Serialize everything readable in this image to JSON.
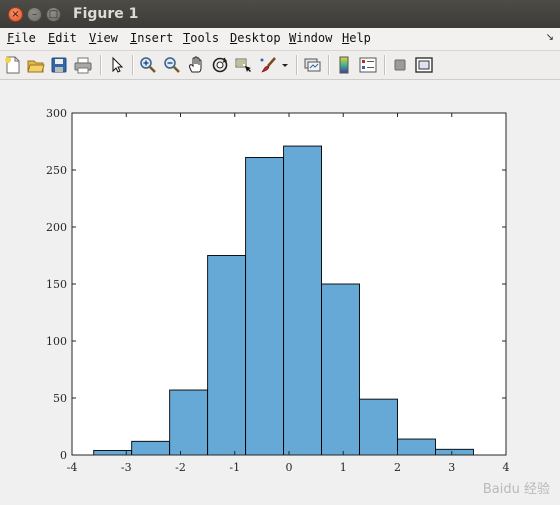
{
  "window": {
    "title": "Figure 1",
    "close_glyph": "×",
    "min_glyph": "–",
    "max_glyph": "□"
  },
  "menu": {
    "items": [
      {
        "underline": "F",
        "rest": "ile"
      },
      {
        "underline": "E",
        "rest": "dit"
      },
      {
        "underline": "V",
        "rest": "iew"
      },
      {
        "underline": "I",
        "rest": "nsert"
      },
      {
        "underline": "T",
        "rest": "ools"
      },
      {
        "underline": "D",
        "rest": "esktop"
      },
      {
        "underline": "W",
        "rest": "indow"
      },
      {
        "underline": "H",
        "rest": "elp"
      }
    ],
    "overflow_glyph": "↘"
  },
  "toolbar": {
    "icons": [
      "new-figure-icon",
      "open-file-icon",
      "save-icon",
      "print-icon",
      "select-arrow-icon",
      "zoom-in-icon",
      "zoom-out-icon",
      "pan-hand-icon",
      "rotate-3d-icon",
      "data-cursor-icon",
      "brush-icon",
      "brush-dropdown-icon",
      "link-plot-icon",
      "colorbar-icon",
      "legend-icon",
      "hide-plot-tools-icon",
      "show-plot-tools-icon"
    ],
    "colors": {
      "bar_fill": "#66a9d6",
      "bar_edge": "#000000"
    }
  },
  "watermark": {
    "text": "Baidu 经验"
  },
  "chart_data": {
    "type": "bar",
    "bin_edges": [
      -3.6,
      -2.9,
      -2.2,
      -1.5,
      -0.8,
      -0.1,
      0.6,
      1.3,
      2.0,
      2.7,
      3.4
    ],
    "values": [
      4,
      12,
      57,
      175,
      261,
      271,
      150,
      49,
      14,
      5
    ],
    "xlim": [
      -4,
      4
    ],
    "ylim": [
      0,
      300
    ],
    "xticks": [
      -4,
      -3,
      -2,
      -1,
      0,
      1,
      2,
      3,
      4
    ],
    "yticks": [
      0,
      50,
      100,
      150,
      200,
      250,
      300
    ],
    "title": "",
    "xlabel": "",
    "ylabel": "",
    "grid": false
  }
}
